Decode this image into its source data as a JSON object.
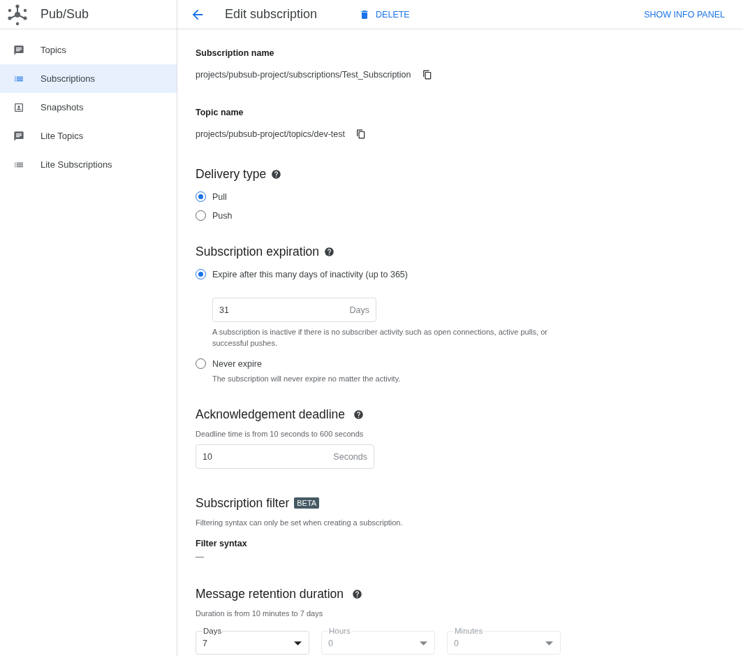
{
  "app": {
    "title": "Pub/Sub"
  },
  "sidebar": {
    "items": [
      {
        "label": "Topics",
        "kind": "topic",
        "selected": false
      },
      {
        "label": "Subscriptions",
        "kind": "list",
        "selected": true
      },
      {
        "label": "Snapshots",
        "kind": "snapshot",
        "selected": false
      },
      {
        "label": "Lite Topics",
        "kind": "topic",
        "selected": false
      },
      {
        "label": "Lite Subscriptions",
        "kind": "list",
        "selected": false
      }
    ]
  },
  "header": {
    "title": "Edit subscription",
    "delete_button": "DELETE",
    "info_panel_button": "SHOW INFO PANEL"
  },
  "sections": [
    {
      "kind": "readonly",
      "label": "Subscription name",
      "value": "projects/pubsub-project/subscriptions/Test_Subscription",
      "copyable": true
    },
    {
      "kind": "readonly",
      "label": "Topic name",
      "value": "projects/pubsub-project/topics/dev-test",
      "copyable": true
    },
    {
      "kind": "radios",
      "heading": "Delivery type",
      "help": true,
      "options": [
        {
          "label": "Pull",
          "selected": true
        },
        {
          "label": "Push",
          "selected": false
        }
      ]
    },
    {
      "kind": "radios",
      "heading": "Subscription expiration",
      "help": true,
      "options": [
        {
          "label": "Expire after this many days of inactivity (up to 365)",
          "selected": true,
          "field": {
            "value": "31",
            "suffix": "Days"
          },
          "description": "A subscription is inactive if there is no subscriber activity such as open connections, active pulls, or successful pushes."
        },
        {
          "label": "Never expire",
          "selected": false,
          "description": "The subscription will never expire no matter the activity."
        }
      ]
    },
    {
      "kind": "number",
      "heading": "Acknowledgement deadline",
      "help": true,
      "hint": "Deadline time is from 10 seconds to 600 seconds",
      "field": {
        "value": "10",
        "suffix": "Seconds"
      }
    },
    {
      "kind": "filter",
      "heading": "Subscription filter",
      "badge": "BETA",
      "hint": "Filtering syntax can only be set when creating a subscription.",
      "label": "Filter syntax",
      "value": "—"
    },
    {
      "kind": "selects",
      "heading": "Message retention duration",
      "help": true,
      "hint": "Duration is from 10 minutes to 7 days",
      "selects": [
        {
          "label": "Days",
          "value": "7",
          "disabled": false
        },
        {
          "label": "Hours",
          "value": "0",
          "disabled": true
        },
        {
          "label": "Minutes",
          "value": "0",
          "disabled": true
        }
      ]
    }
  ]
}
